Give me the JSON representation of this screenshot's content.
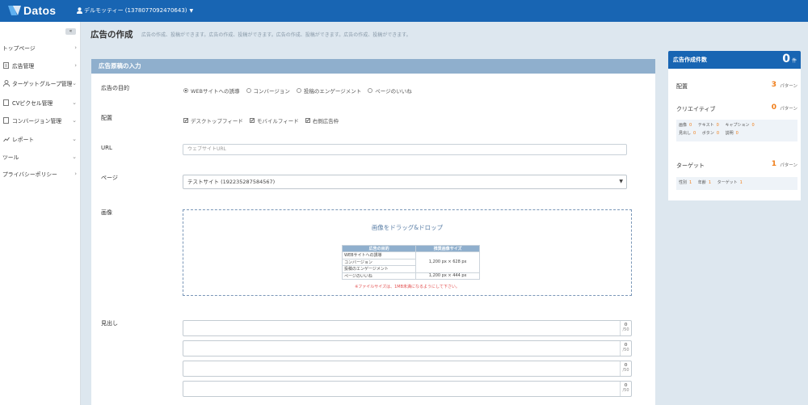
{
  "app": {
    "logo_text": "Datos",
    "user_label": "デルモッティー (1378077092470643)",
    "brand_color": "#1865b3",
    "accent_color": "#f07d18"
  },
  "sidebar": {
    "collapse_label": "«",
    "items": [
      {
        "label": "トップページ",
        "icon": "",
        "chev": "›"
      },
      {
        "label": "広告管理",
        "icon": "document-icon",
        "chev": "›"
      },
      {
        "label": "ターゲットグループ管理",
        "icon": "person-icon",
        "chev": "›"
      },
      {
        "label": "CVピクセル管理",
        "icon": "document-icon",
        "chev": "›"
      },
      {
        "label": "コンバージョン管理",
        "icon": "document-icon",
        "chev": "›"
      },
      {
        "label": "レポート",
        "icon": "chart-icon",
        "chev": "›"
      },
      {
        "label": "ツール",
        "icon": "",
        "chev": "›"
      },
      {
        "label": "プライバシーポリシー",
        "icon": "",
        "chev": "›"
      }
    ]
  },
  "page": {
    "title": "広告の作成",
    "subtitle": "広告の作成、投稿ができます。広告の作成、投稿ができます。広告の作成、投稿ができます。広告の作成、投稿ができます。"
  },
  "form": {
    "panel_title": "広告原稿の入力",
    "objective": {
      "label": "広告の目的",
      "options": [
        {
          "label": "WEBサイトへの誘導",
          "selected": true
        },
        {
          "label": "コンバージョン",
          "selected": false
        },
        {
          "label": "投稿のエンゲージメント",
          "selected": false
        },
        {
          "label": "ページのいいね",
          "selected": false
        }
      ]
    },
    "placement": {
      "label": "配置",
      "options": [
        {
          "label": "デスクトップフィード",
          "checked": true
        },
        {
          "label": "モバイルフィード",
          "checked": true
        },
        {
          "label": "右側広告枠",
          "checked": true
        }
      ]
    },
    "url": {
      "label": "URL",
      "placeholder": "ウェブサイトURL",
      "value": ""
    },
    "page": {
      "label": "ページ",
      "selected": "テストサイト (192235287584567)",
      "arrow": "▼"
    },
    "image": {
      "label": "画像",
      "drop_title": "画像をドラッグ&ドロップ",
      "table_headers": [
        "広告の目的",
        "推奨画像サイズ"
      ],
      "table_rows": [
        [
          "WEBサイトへの誘導",
          "1,200 px × 628 px"
        ],
        [
          "コンバージョン",
          ""
        ],
        [
          "投稿のエンゲージメント",
          ""
        ],
        [
          "ページのいいね",
          "1,200 px × 444 px"
        ]
      ],
      "note": "※ファイルサイズは、1MB未満になるようにして下さい。"
    },
    "headline": {
      "label": "見出し",
      "boxes": [
        {
          "count": "0",
          "max": "/50"
        },
        {
          "count": "0",
          "max": "/50"
        },
        {
          "count": "0",
          "max": "/50"
        },
        {
          "count": "0",
          "max": "/50"
        }
      ]
    }
  },
  "summary": {
    "title": "広告作成件数",
    "total": "0",
    "total_unit": "件",
    "placement": {
      "label": "配置",
      "count": "3",
      "unit": "パターン"
    },
    "creative": {
      "label": "クリエイティブ",
      "count": "0",
      "unit": "パターン",
      "details_row1": [
        {
          "label": "画像",
          "value": "0"
        },
        {
          "label": "テキスト",
          "value": "0"
        },
        {
          "label": "キャプション",
          "value": "0"
        }
      ],
      "details_row2": [
        {
          "label": "見出し",
          "value": "0"
        },
        {
          "label": "ボタン",
          "value": "0"
        },
        {
          "label": "説明",
          "value": "0"
        }
      ]
    },
    "target": {
      "label": "ターゲット",
      "count": "1",
      "unit": "パターン",
      "details": [
        {
          "label": "性別",
          "value": "1"
        },
        {
          "label": "年齢",
          "value": "1"
        },
        {
          "label": "ターゲット",
          "value": "1"
        }
      ]
    }
  }
}
